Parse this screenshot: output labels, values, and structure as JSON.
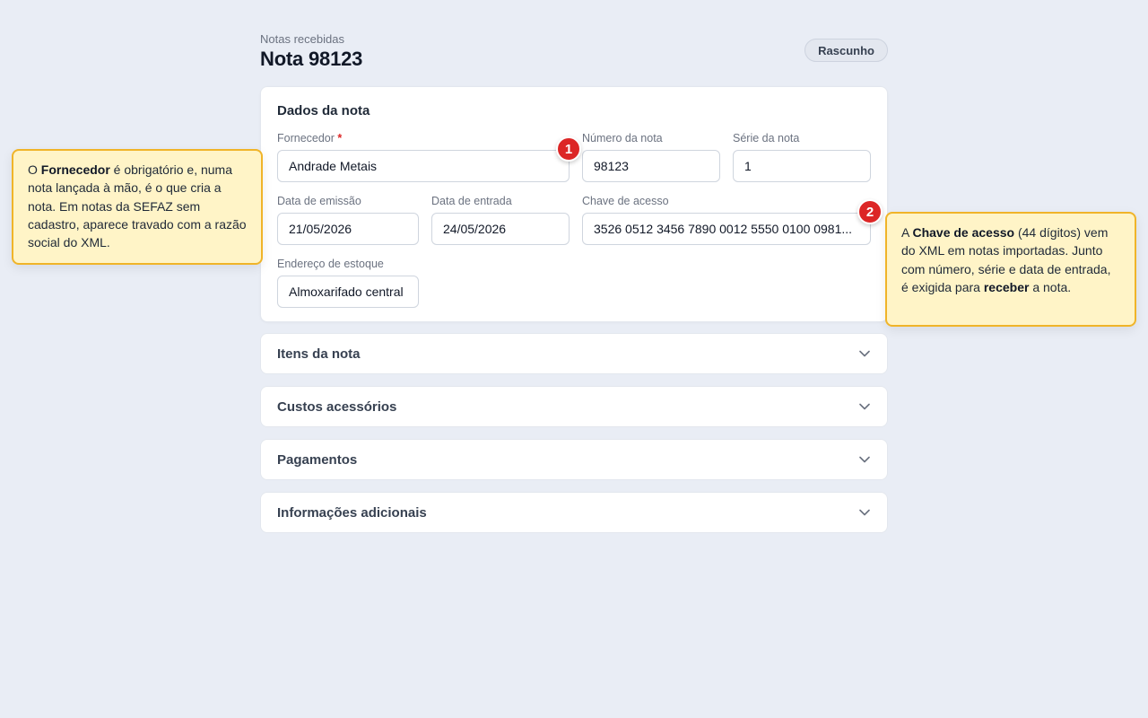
{
  "header": {
    "breadcrumb": "Notas recebidas",
    "title": "Nota 98123",
    "status": "Rascunho"
  },
  "dados": {
    "title": "Dados da nota",
    "fornecedor": {
      "label": "Fornecedor",
      "required_mark": "*",
      "value": "Andrade Metais"
    },
    "numero": {
      "label": "Número da nota",
      "value": "98123"
    },
    "serie": {
      "label": "Série da nota",
      "value": "1"
    },
    "emissao": {
      "label": "Data de emissão",
      "value": "21/05/2026"
    },
    "entrada": {
      "label": "Data de entrada",
      "value": "24/05/2026"
    },
    "chave": {
      "label": "Chave de acesso",
      "value": "3526 0512 3456 7890 0012 5550 0100 0981..."
    },
    "endereco": {
      "label": "Endereço de estoque",
      "value": "Almoxarifado central"
    }
  },
  "sections": [
    {
      "label": "Itens da nota"
    },
    {
      "label": "Custos acessórios"
    },
    {
      "label": "Pagamentos"
    },
    {
      "label": "Informações adicionais"
    }
  ],
  "callouts": {
    "one": {
      "marker": "1",
      "t1": "O ",
      "b1": "Fornecedor",
      "t2": " é obrigatório e, numa nota lançada à mão, é o que cria a nota. Em notas da SEFAZ sem cadastro, aparece travado com a razão social do XML."
    },
    "two": {
      "marker": "2",
      "t1": "A ",
      "b1": "Chave de acesso",
      "t2": " (44 dígitos) vem do XML em notas importadas. Junto com número, série e data de entrada, é exigida para ",
      "b2": "receber",
      "t3": " a nota."
    }
  },
  "colors": {
    "background": "#e9edf5",
    "callout_bg": "#fff4c7",
    "callout_border": "#f0b429",
    "marker": "#dc2626"
  },
  "icons": {
    "section_toggle": "chevron-down-icon"
  }
}
